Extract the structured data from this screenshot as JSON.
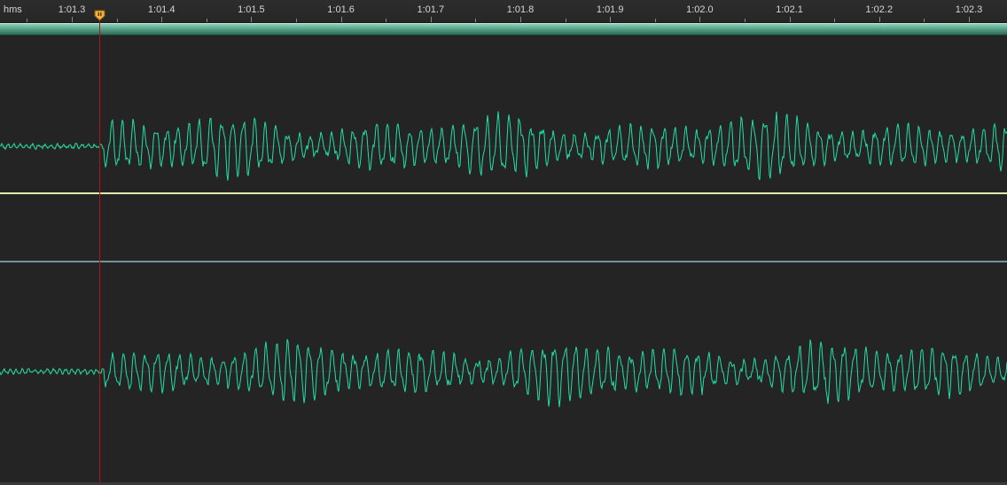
{
  "ruler": {
    "unit_label": "hms",
    "ticks": [
      "1:01.3",
      "1:01.4",
      "1:01.5",
      "1:01.6",
      "1:01.7",
      "1:01.8",
      "1:01.9",
      "1:02.0",
      "1:02.1",
      "1:02.2",
      "1:02.3"
    ]
  },
  "colors": {
    "waveform": "#1fe0a8",
    "channel_divider": "#e8e8b4",
    "lower_boundary": "#8fb8c0",
    "playhead": "#b31313",
    "playhead_marker": "#f2b33a",
    "background": "#242424"
  },
  "icons": {
    "playhead_marker": "playhead-marker-icon"
  }
}
